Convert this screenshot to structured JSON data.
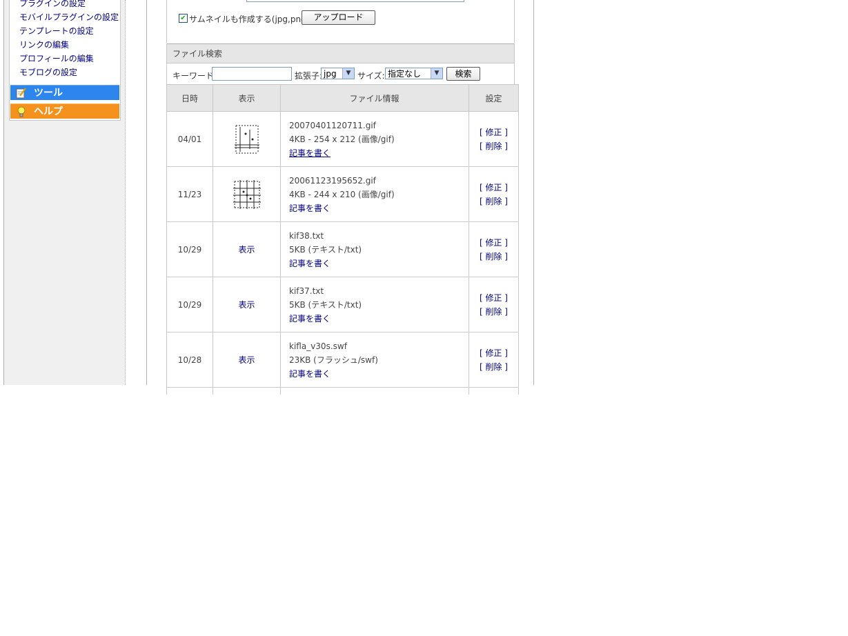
{
  "sidebar": {
    "menu_items": [
      "プラグインの設定",
      "モバイルプラグインの設定",
      "テンプレートの設定",
      "リンクの編集",
      "プロフィールの編集",
      "モブログの設定"
    ],
    "nav_tools": "ツール",
    "nav_help": "ヘルプ",
    "colors": {
      "tools": "#2d86ee",
      "help": "#f5921e"
    }
  },
  "upload": {
    "thumbnail_label": "サムネイルも作成する(jpg,png)",
    "thumbnail_checked": true,
    "upload_button": "アップロード"
  },
  "search": {
    "header": "ファイル検索",
    "keyword_label": "キーワード:",
    "keyword_value": "",
    "ext_label": "拡張子:",
    "ext_value": "jpg",
    "size_label": "サイズ:",
    "size_value": "指定なし",
    "search_button": "検索"
  },
  "table": {
    "headers": {
      "date": "日時",
      "view": "表示",
      "info": "ファイル情報",
      "settings": "設定"
    },
    "rows": [
      {
        "date": "04/01",
        "view": "thumbnail",
        "filename": "20070401120711.gif",
        "meta": "4KB - 254 x 212 (画像/gif)",
        "write": "記事を書く",
        "edit": "[ 修正 ]",
        "delete": "[ 削除 ]"
      },
      {
        "date": "11/23",
        "view": "thumbnail",
        "filename": "20061123195652.gif",
        "meta": "4KB - 244 x 210 (画像/gif)",
        "write": "記事を書く",
        "edit": "[ 修正 ]",
        "delete": "[ 削除 ]"
      },
      {
        "date": "10/29",
        "view": "表示",
        "filename": "kif38.txt",
        "meta": "5KB (テキスト/txt)",
        "write": "記事を書く",
        "edit": "[ 修正 ]",
        "delete": "[ 削除 ]"
      },
      {
        "date": "10/29",
        "view": "表示",
        "filename": "kif37.txt",
        "meta": "5KB (テキスト/txt)",
        "write": "記事を書く",
        "edit": "[ 修正 ]",
        "delete": "[ 削除 ]"
      },
      {
        "date": "10/28",
        "view": "表示",
        "filename": "kifla_v30s.swf",
        "meta": "23KB (フラッシュ/swf)",
        "write": "記事を書く",
        "edit": "[ 修正 ]",
        "delete": "[ 削除 ]"
      }
    ]
  }
}
